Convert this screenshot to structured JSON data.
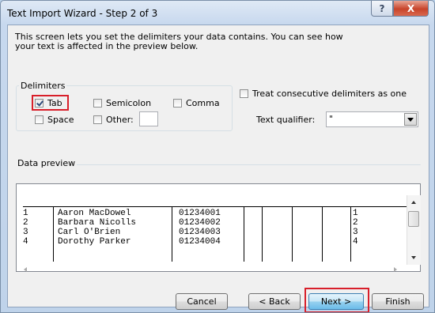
{
  "window": {
    "title": "Text Import Wizard - Step 2 of 3",
    "help_glyph": "?",
    "close_glyph": "X"
  },
  "intro": "This screen lets you set the delimiters your data contains.  You can see how your text is affected in the preview below.",
  "delimiters": {
    "label": "Delimiters",
    "tab": {
      "label": "Tab",
      "checked": true
    },
    "semicolon": {
      "label": "Semicolon",
      "checked": false
    },
    "comma": {
      "label": "Comma",
      "checked": false
    },
    "space": {
      "label": "Space",
      "checked": false
    },
    "other": {
      "label": "Other:",
      "checked": false,
      "value": ""
    }
  },
  "consecutive": {
    "label": "Treat consecutive delimiters as one",
    "checked": false
  },
  "qualifier": {
    "label": "Text qualifier:",
    "value": "\""
  },
  "preview": {
    "label": "Data preview",
    "rows": [
      [
        "1",
        "Aaron MacDowel",
        "01234001",
        "1"
      ],
      [
        "2",
        "Barbara Nicolls",
        "01234002",
        "2"
      ],
      [
        "3",
        "Carl O'Brien",
        "01234003",
        "3"
      ],
      [
        "4",
        "Dorothy Parker",
        "01234004",
        "4"
      ]
    ]
  },
  "buttons": {
    "cancel": "Cancel",
    "back": "< Back",
    "next": "Next >",
    "finish": "Finish"
  },
  "colors": {
    "highlight": "#d81f2a",
    "close_button": "#c8442a"
  }
}
